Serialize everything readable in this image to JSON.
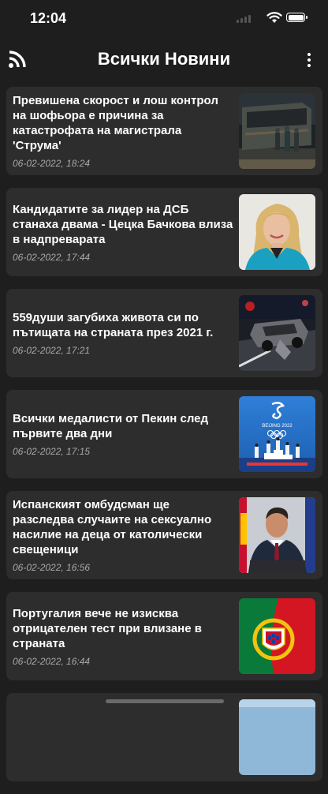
{
  "status_bar": {
    "time": "12:04"
  },
  "app_bar": {
    "title": "Всички Новини"
  },
  "articles": [
    {
      "headline": "Превишена скорост и лош контрол на шофьора е причина за катастрофата на магистрала 'Струма'",
      "date": "06-02-2022, 18:24",
      "image": "burnt-bus-photo"
    },
    {
      "headline": "Кандидатите за лидер на ДСБ станаха двама - Цецка Бачкова влиза в надпреварата",
      "date": "06-02-2022, 17:44",
      "image": "woman-portrait-photo"
    },
    {
      "headline": "559души загубиха живота си по пътищата на страната през 2021 г.",
      "date": "06-02-2022, 17:21",
      "image": "car-crash-photo"
    },
    {
      "headline": "Всички медалисти от Пекин след първите два дни",
      "date": "06-02-2022, 17:15",
      "image": "beijing-2022-podium-photo",
      "image_text": "BEIJING 2022"
    },
    {
      "headline": "Испанският омбудсман ще разследва случаите на сексуално насилие на деца от католически свещеници",
      "date": "06-02-2022, 16:56",
      "image": "man-at-podium-photo"
    },
    {
      "headline": "Португалия вече не изисква отрицателен тест при влизане в страната",
      "date": "06-02-2022, 16:44",
      "image": "portugal-flag-photo"
    }
  ]
}
